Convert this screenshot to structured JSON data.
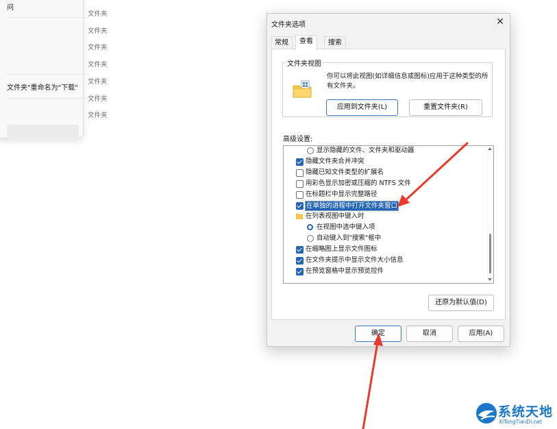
{
  "background_explorer": {
    "rows": [
      "问",
      "文件夹\"重命名为\"下载\""
    ],
    "type_column": [
      "文件夹",
      "文件夹",
      "文件夹",
      "文件夹",
      "文件夹",
      "文件夹",
      "文件夹"
    ]
  },
  "dialog": {
    "title": "文件夹选项",
    "close_glyph": "✕",
    "tabs": [
      {
        "label": "常规",
        "active": false
      },
      {
        "label": "查看",
        "active": true
      },
      {
        "label": "搜索",
        "active": false
      }
    ],
    "folder_view": {
      "legend": "文件夹视图",
      "description": "你可以将此视图(如详细信息或图标)应用于这种类型的所有文件夹。",
      "apply_button": "应用到文件夹(L)",
      "reset_button": "重置文件夹(R)"
    },
    "advanced_label": "高级设置:",
    "advanced_items": [
      {
        "kind": "radio",
        "checked": false,
        "indent": 2,
        "label": "显示隐藏的文件、文件夹和驱动器"
      },
      {
        "kind": "checkbox",
        "checked": true,
        "indent": 1,
        "label": "隐藏文件夹合并冲突"
      },
      {
        "kind": "checkbox",
        "checked": false,
        "indent": 1,
        "label": "隐藏已知文件类型的扩展名"
      },
      {
        "kind": "checkbox",
        "checked": false,
        "indent": 1,
        "label": "用彩色显示加密或压缩的 NTFS 文件"
      },
      {
        "kind": "checkbox",
        "checked": false,
        "indent": 1,
        "label": "在标题栏中显示完整路径"
      },
      {
        "kind": "checkbox",
        "checked": true,
        "indent": 1,
        "selected": true,
        "label": "在单独的进程中打开文件夹窗口"
      },
      {
        "kind": "folder",
        "indent": 1,
        "label": "在列表视图中键入时"
      },
      {
        "kind": "radio",
        "checked": true,
        "indent": 2,
        "label": "在视图中选中键入项"
      },
      {
        "kind": "radio",
        "checked": false,
        "indent": 2,
        "label": "自动键入到\"搜索\"框中"
      },
      {
        "kind": "checkbox",
        "checked": true,
        "indent": 1,
        "label": "在缩略图上显示文件图标"
      },
      {
        "kind": "checkbox",
        "checked": true,
        "indent": 1,
        "label": "在文件夹提示中显示文件大小信息"
      },
      {
        "kind": "checkbox",
        "checked": true,
        "indent": 1,
        "label": "在预览窗格中显示预览控件"
      }
    ],
    "restore_defaults_button": "还原为默认值(D)",
    "footer": {
      "ok_button": "确定",
      "cancel_button": "取消",
      "apply_button": "应用(A)"
    }
  },
  "annotation_color": "#e8392b",
  "accent_color": "#2364b5",
  "watermark": {
    "name": "系统天地",
    "url": "XiTongTianDi.net"
  }
}
